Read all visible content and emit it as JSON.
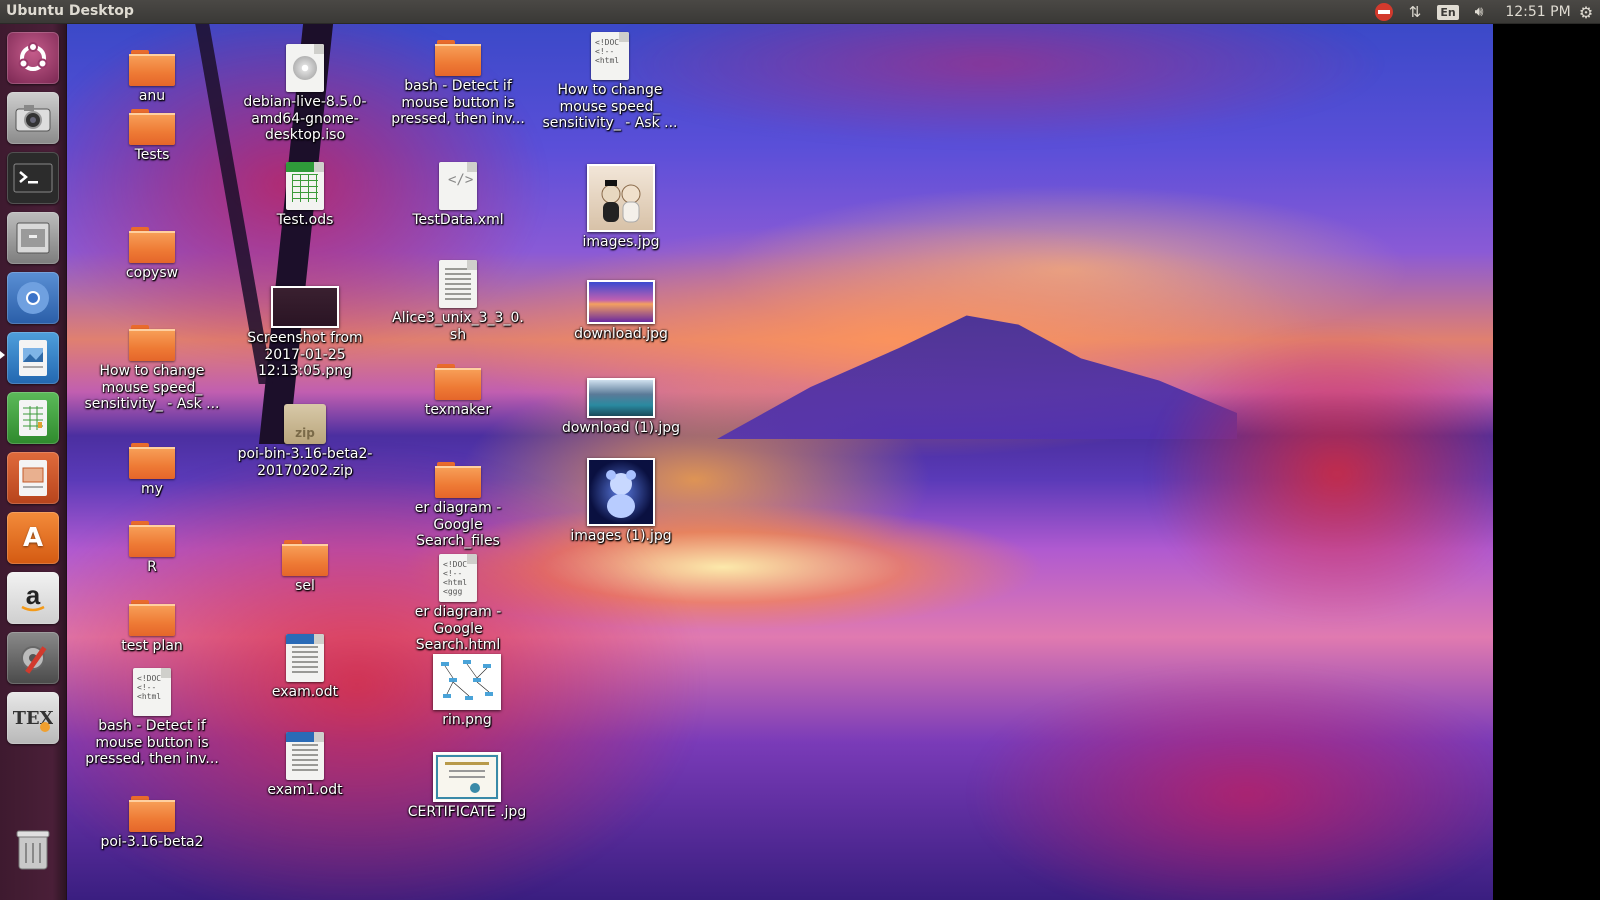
{
  "topbar": {
    "title": "Ubuntu Desktop",
    "keyboard": "En",
    "clock": "12:51 PM"
  },
  "launcher": {
    "items": [
      {
        "name": "Dash home",
        "icon": "ubuntu-logo-icon"
      },
      {
        "name": "Cheese camera",
        "icon": "camera-icon"
      },
      {
        "name": "Terminal",
        "icon": "terminal-icon"
      },
      {
        "name": "Files",
        "icon": "file-cabinet-icon"
      },
      {
        "name": "Chromium",
        "icon": "chromium-icon"
      },
      {
        "name": "Image Viewer",
        "icon": "image-viewer-icon"
      },
      {
        "name": "LibreOffice Calc",
        "icon": "spreadsheet-icon"
      },
      {
        "name": "LibreOffice Impress",
        "icon": "presentation-icon"
      },
      {
        "name": "Ubuntu Software",
        "icon": "software-center-icon"
      },
      {
        "name": "Amazon",
        "icon": "amazon-icon"
      },
      {
        "name": "System Settings",
        "icon": "settings-icon"
      },
      {
        "name": "Texmaker",
        "icon": "texmaker-icon"
      },
      {
        "name": "Trash",
        "icon": "trash-icon"
      }
    ]
  },
  "desktop": {
    "icons": [
      {
        "label": "anu",
        "type": "folder"
      },
      {
        "label": "Tests",
        "type": "folder"
      },
      {
        "label": "copysw",
        "type": "folder"
      },
      {
        "label": "How to change mouse speed_ sensitivity_ - Ask ...",
        "type": "folder"
      },
      {
        "label": "my",
        "type": "folder"
      },
      {
        "label": "R",
        "type": "folder"
      },
      {
        "label": "test plan",
        "type": "folder"
      },
      {
        "label": "bash - Detect if mouse button is pressed, then inv...",
        "type": "html"
      },
      {
        "label": "poi-3.16-beta2",
        "type": "folder"
      },
      {
        "label": "debian-live-8.5.0-amd64-gnome-desktop.iso",
        "type": "iso"
      },
      {
        "label": "Test.ods",
        "type": "spreadsheet"
      },
      {
        "label": "Screenshot from 2017-01-25 12:13:05.png",
        "type": "image"
      },
      {
        "label": "poi-bin-3.16-beta2-20170202.zip",
        "type": "zip"
      },
      {
        "label": "sel",
        "type": "folder"
      },
      {
        "label": "exam.odt",
        "type": "document"
      },
      {
        "label": "exam1.odt",
        "type": "document"
      },
      {
        "label": "bash - Detect if mouse button is pressed, then inv...",
        "type": "folder"
      },
      {
        "label": "TestData.xml",
        "type": "xml"
      },
      {
        "label": "Alice3_unix_3_3_0.sh",
        "type": "script"
      },
      {
        "label": "texmaker",
        "type": "folder"
      },
      {
        "label": "er diagram - Google Search_files",
        "type": "folder"
      },
      {
        "label": "er diagram - Google Search.html",
        "type": "html"
      },
      {
        "label": "rin.png",
        "type": "image"
      },
      {
        "label": "CERTIFICATE .jpg",
        "type": "image"
      },
      {
        "label": "How to change mouse speed_ sensitivity_ - Ask ...",
        "type": "html"
      },
      {
        "label": "images.jpg",
        "type": "image"
      },
      {
        "label": "download.jpg",
        "type": "image"
      },
      {
        "label": "download (1).jpg",
        "type": "image"
      },
      {
        "label": "images (1).jpg",
        "type": "image"
      }
    ]
  }
}
